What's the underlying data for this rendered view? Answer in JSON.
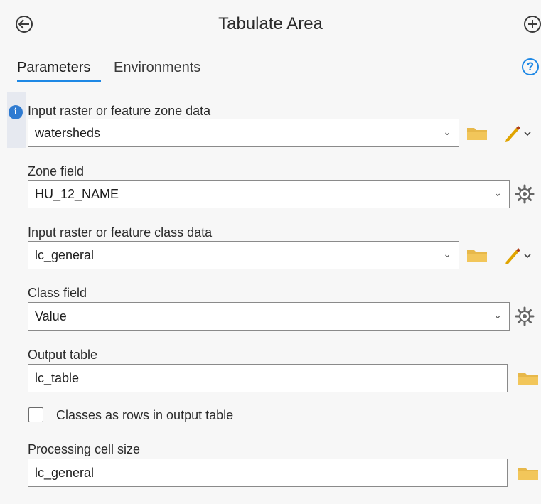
{
  "header": {
    "title": "Tabulate Area"
  },
  "tabs": [
    {
      "label": "Parameters",
      "active": true
    },
    {
      "label": "Environments",
      "active": false
    }
  ],
  "help_symbol": "?",
  "info_symbol": "i",
  "parameters": {
    "input_zone": {
      "label": "Input raster or feature zone data",
      "value": "watersheds"
    },
    "zone_field": {
      "label": "Zone field",
      "value": "HU_12_NAME"
    },
    "input_class": {
      "label": "Input raster or feature class data",
      "value": "lc_general"
    },
    "class_field": {
      "label": "Class field",
      "value": "Value"
    },
    "output_table": {
      "label": "Output table",
      "value": "lc_table"
    },
    "classes_as_rows": {
      "label": "Classes as rows in output table",
      "checked": false
    },
    "cell_size": {
      "label": "Processing cell size",
      "value": "lc_general"
    }
  },
  "colors": {
    "accent": "#1e88e5",
    "folder": "#e7b84a",
    "pencil": "#e0a400"
  },
  "icons": [
    "back-arrow-icon",
    "add-icon",
    "help-icon",
    "info-icon",
    "chevron-down-icon",
    "folder-icon",
    "pencil-icon",
    "gear-icon"
  ]
}
